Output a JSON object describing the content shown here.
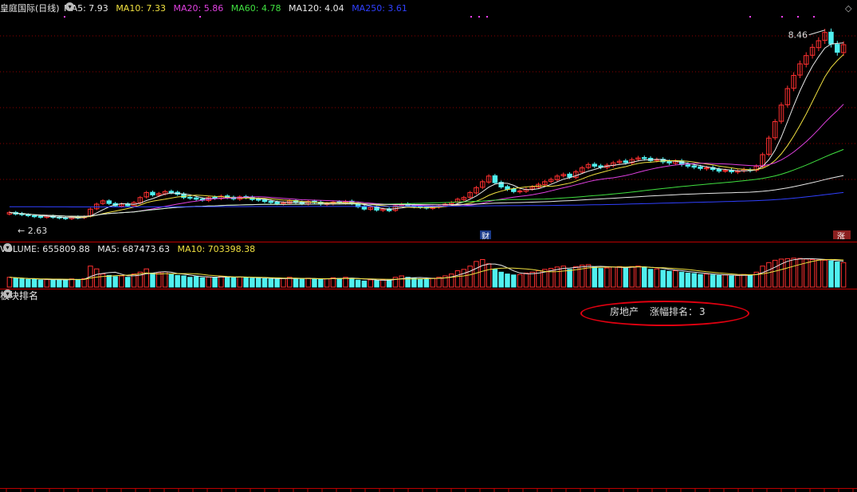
{
  "header": {
    "stock_name": "皇庭国际(日线)",
    "ma": [
      {
        "label": "MA5: 7.93",
        "color": "#e8e8e8"
      },
      {
        "label": "MA10: 7.33",
        "color": "#f0e040"
      },
      {
        "label": "MA20: 5.86",
        "color": "#e040e0"
      },
      {
        "label": "MA60: 4.78",
        "color": "#40e040"
      },
      {
        "label": "MA120: 4.04",
        "color": "#e8e8e8"
      },
      {
        "label": "MA250: 3.61",
        "color": "#3040ff"
      }
    ]
  },
  "volume_header": {
    "volume": "VOLUME: 655809.88",
    "ma5": "MA5: 687473.63",
    "ma10": "MA10: 703398.38"
  },
  "panel_title": "板块排名",
  "ranking": {
    "sector": "房地产",
    "label": "涨幅排名：",
    "value": "3"
  },
  "markers": {
    "cai": "财",
    "rongzhang": "涨"
  },
  "colors": {
    "up": "#ff3030",
    "down": "#50f0f0",
    "bg": "#000000",
    "grid": "#8b0000"
  },
  "chart_data": {
    "type": "candlestick",
    "annotations": [
      {
        "text": "8.46",
        "kind": "high"
      },
      {
        "text": "2.63",
        "kind": "low"
      }
    ],
    "ylim": [
      2.4,
      8.8
    ],
    "closes": [
      2.85,
      2.8,
      2.78,
      2.75,
      2.72,
      2.7,
      2.74,
      2.7,
      2.68,
      2.66,
      2.71,
      2.68,
      2.72,
      2.95,
      3.1,
      3.2,
      3.12,
      3.05,
      3.1,
      3.05,
      3.15,
      3.3,
      3.45,
      3.38,
      3.42,
      3.48,
      3.45,
      3.4,
      3.3,
      3.28,
      3.25,
      3.22,
      3.3,
      3.28,
      3.34,
      3.3,
      3.26,
      3.32,
      3.3,
      3.24,
      3.22,
      3.18,
      3.15,
      3.12,
      3.14,
      3.2,
      3.15,
      3.12,
      3.18,
      3.15,
      3.1,
      3.12,
      3.16,
      3.14,
      3.18,
      3.12,
      3.02,
      2.95,
      3.0,
      2.92,
      2.95,
      2.9,
      3.05,
      3.1,
      3.05,
      3.02,
      3.0,
      2.98,
      3.02,
      3.05,
      3.1,
      3.15,
      3.25,
      3.3,
      3.45,
      3.6,
      3.78,
      3.95,
      3.75,
      3.62,
      3.55,
      3.48,
      3.5,
      3.55,
      3.62,
      3.7,
      3.78,
      3.85,
      3.95,
      4.0,
      3.92,
      4.08,
      4.2,
      4.3,
      4.25,
      4.22,
      4.28,
      4.35,
      4.4,
      4.36,
      4.45,
      4.5,
      4.48,
      4.42,
      4.45,
      4.38,
      4.35,
      4.4,
      4.3,
      4.25,
      4.22,
      4.18,
      4.2,
      4.15,
      4.1,
      4.12,
      4.08,
      4.1,
      4.15,
      4.12,
      4.25,
      4.6,
      5.1,
      5.6,
      6.1,
      6.6,
      7.0,
      7.35,
      7.6,
      7.85,
      8.05,
      8.3,
      7.95,
      7.7,
      7.93
    ],
    "opens": [
      2.8,
      2.85,
      2.82,
      2.78,
      2.75,
      2.73,
      2.7,
      2.74,
      2.71,
      2.69,
      2.66,
      2.72,
      2.69,
      2.74,
      2.96,
      3.12,
      3.2,
      3.12,
      3.04,
      3.11,
      3.05,
      3.14,
      3.32,
      3.46,
      3.37,
      3.41,
      3.49,
      3.46,
      3.41,
      3.31,
      3.29,
      3.26,
      3.21,
      3.31,
      3.27,
      3.35,
      3.31,
      3.25,
      3.33,
      3.31,
      3.25,
      3.23,
      3.19,
      3.16,
      3.11,
      3.13,
      3.21,
      3.16,
      3.11,
      3.19,
      3.16,
      3.09,
      3.11,
      3.17,
      3.13,
      3.19,
      3.13,
      3.03,
      2.94,
      3.01,
      2.91,
      2.96,
      2.91,
      3.06,
      3.11,
      3.06,
      3.03,
      3.01,
      2.97,
      3.01,
      3.06,
      3.11,
      3.16,
      3.24,
      3.31,
      3.44,
      3.61,
      3.77,
      3.96,
      3.76,
      3.63,
      3.56,
      3.47,
      3.49,
      3.56,
      3.61,
      3.69,
      3.79,
      3.84,
      3.96,
      4.01,
      3.91,
      4.07,
      4.21,
      4.31,
      4.26,
      4.21,
      4.27,
      4.36,
      4.41,
      4.35,
      4.46,
      4.51,
      4.49,
      4.43,
      4.46,
      4.39,
      4.34,
      4.41,
      4.31,
      4.26,
      4.23,
      4.17,
      4.21,
      4.16,
      4.11,
      4.13,
      4.07,
      4.11,
      4.14,
      4.13,
      4.24,
      4.61,
      5.11,
      5.61,
      6.11,
      6.61,
      7.01,
      7.34,
      7.61,
      7.84,
      8.06,
      8.31,
      7.94,
      7.69
    ],
    "ma_series": [
      {
        "name": "MA5",
        "color": "#e8e8e8"
      },
      {
        "name": "MA10",
        "color": "#f0e040"
      },
      {
        "name": "MA20",
        "color": "#e040e0"
      },
      {
        "name": "MA60",
        "color": "#40e040"
      },
      {
        "name": "MA120",
        "color": "#e8e8e8"
      },
      {
        "name": "MA250",
        "color": "#3040ff"
      }
    ],
    "volume_max": 1300000,
    "volumes": [
      420,
      380,
      350,
      330,
      340,
      300,
      320,
      310,
      330,
      300,
      350,
      330,
      360,
      900,
      780,
      560,
      500,
      450,
      480,
      420,
      560,
      640,
      780,
      600,
      620,
      650,
      540,
      500,
      480,
      420,
      450,
      400,
      430,
      420,
      460,
      440,
      400,
      430,
      420,
      380,
      390,
      360,
      350,
      340,
      370,
      420,
      360,
      340,
      380,
      350,
      330,
      360,
      400,
      370,
      420,
      380,
      300,
      260,
      310,
      280,
      320,
      300,
      420,
      480,
      420,
      380,
      350,
      330,
      380,
      420,
      480,
      560,
      700,
      760,
      900,
      1100,
      1180,
      1000,
      760,
      640,
      560,
      520,
      540,
      600,
      640,
      700,
      760,
      800,
      860,
      900,
      760,
      880,
      940,
      960,
      860,
      800,
      820,
      860,
      880,
      820,
      880,
      900,
      860,
      760,
      780,
      720,
      680,
      700,
      640,
      600,
      580,
      540,
      560,
      520,
      500,
      520,
      480,
      500,
      540,
      520,
      640,
      900,
      1050,
      1150,
      1200,
      1220,
      1240,
      1230,
      1200,
      1180,
      1160,
      1150,
      1120,
      1080,
      1050
    ]
  }
}
